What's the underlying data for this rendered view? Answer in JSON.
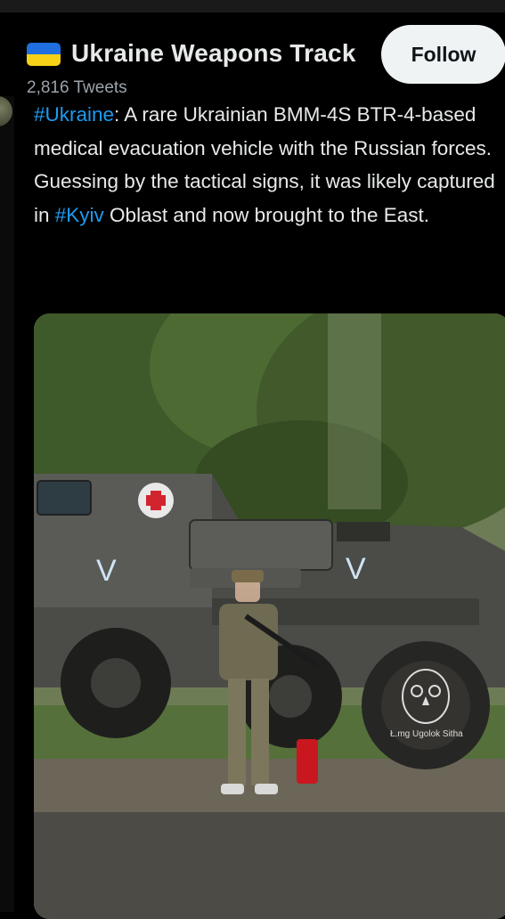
{
  "header": {
    "flag_icon": "ukraine-flag-icon",
    "title": "Ukraine Weapons Track",
    "tweets_count": "2,816 Tweets",
    "follow_label": "Follow"
  },
  "tweet": {
    "hashtag1": "#Ukraine",
    "text1": ": A rare Ukrainian BMM-4S BTR-4-based medical evacuation vehicle with the Russian forces.",
    "text2a": "Guessing by the tactical signs, it was likely captured in ",
    "hashtag2": "#Kyiv",
    "text2b": " Oblast and now brought to the East."
  },
  "media": {
    "vehicle_mark": "V",
    "vehicle_mark_2": "V",
    "watermark": "Ł.mg Ugolok Sitha"
  },
  "colors": {
    "background": "#000000",
    "link": "#1d9bf0",
    "follow_bg": "#eff3f4"
  }
}
